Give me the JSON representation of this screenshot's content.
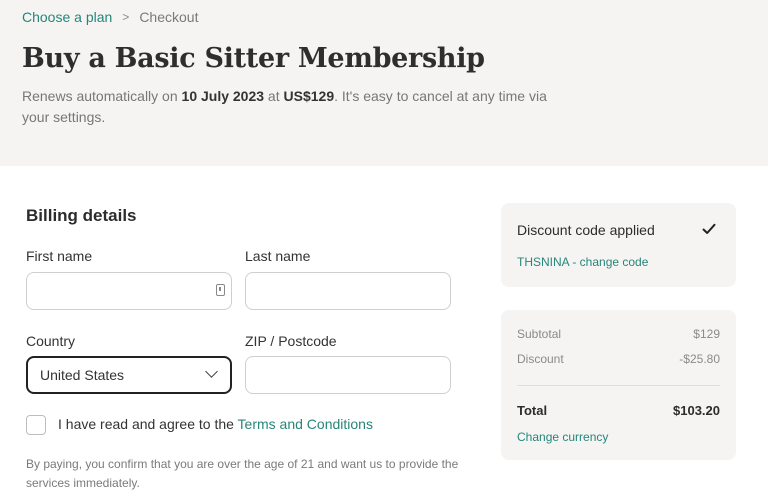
{
  "breadcrumb": {
    "link": "Choose a plan",
    "separator": ">",
    "current": "Checkout"
  },
  "header": {
    "title": "Buy a Basic Sitter Membership",
    "renew_prefix": "Renews automatically on ",
    "renew_date": "10 July 2023",
    "renew_mid": " at ",
    "renew_price": "US$129",
    "renew_suffix": ". It's easy to cancel at any time via your settings."
  },
  "billing": {
    "title": "Billing details",
    "first_name_label": "First name",
    "first_name_value": "",
    "last_name_label": "Last name",
    "last_name_value": "",
    "country_label": "Country",
    "country_value": "United States",
    "zip_label": "ZIP / Postcode",
    "zip_value": "",
    "agree_text": "I have read and agree to the ",
    "terms_link": "Terms and Conditions",
    "disclaimer": "By paying, you confirm that you are over the age of 21 and want us to provide the services immediately."
  },
  "discount": {
    "title": "Discount code applied",
    "code_link": "THSNINA - change code",
    "checked": true
  },
  "summary": {
    "subtotal_label": "Subtotal",
    "subtotal_value": "$129",
    "discount_label": "Discount",
    "discount_value": "-$25.80",
    "total_label": "Total",
    "total_value": "$103.20",
    "change_currency": "Change currency"
  },
  "colors": {
    "accent": "#26867a",
    "hero_bg": "#f5f4f3",
    "card_bg": "#f5f4f3"
  }
}
